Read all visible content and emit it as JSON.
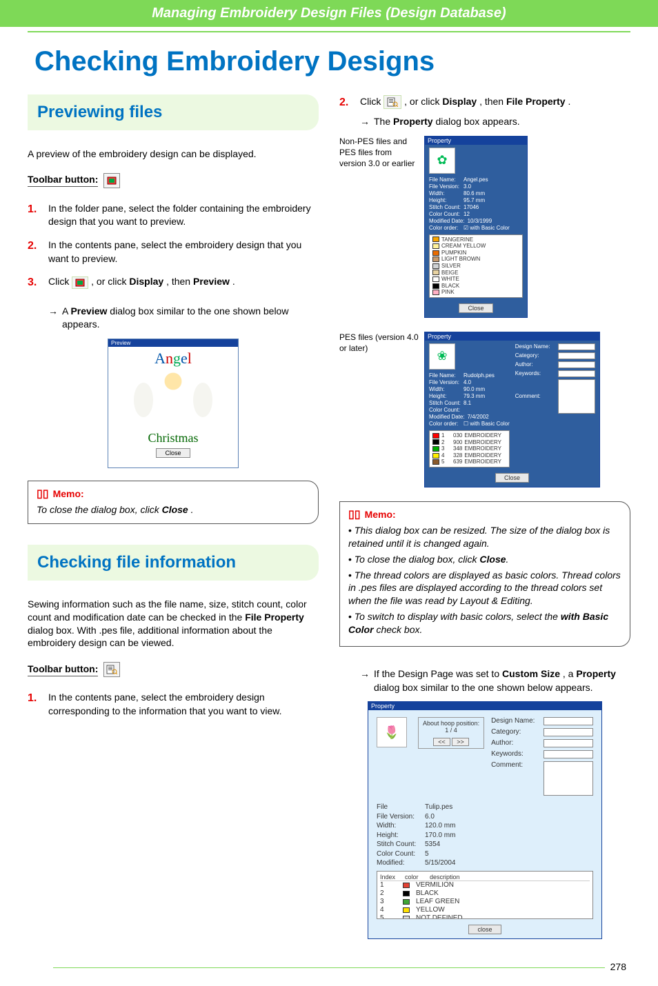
{
  "header": {
    "breadcrumb": "Managing Embroidery Design Files (Design Database)"
  },
  "title": "Checking Embroidery Designs",
  "section1": {
    "heading": "Previewing files",
    "intro": "A preview of the embroidery design can be displayed.",
    "toolbar_label": "Toolbar button:",
    "steps": {
      "s1": "In the folder pane, select the folder containing the embroidery design that you want to preview.",
      "s2": "In the contents pane, select the embroidery design that you want to preview.",
      "s3a": "Click ",
      "s3b": ", or click ",
      "s3_display": "Display",
      "s3_then": ", then ",
      "s3_preview": "Preview",
      "s3_period": "."
    },
    "result_a": "A ",
    "result_b": "Preview",
    "result_c": " dialog box similar to the one shown below appears.",
    "preview_dialog": {
      "title": "Preview",
      "word1": "Angel",
      "word2": "Christmas",
      "close": "Close"
    },
    "memo_label": "Memo:",
    "memo_text_a": "To close the dialog box, click ",
    "memo_text_b": "Close",
    "memo_text_c": "."
  },
  "section2": {
    "heading": "Checking file information",
    "intro_a": "Sewing information such as the file name, size, stitch count, color count and modification date can be checked in the ",
    "intro_b": "File Property",
    "intro_c": " dialog box. With .pes file, additional information about the embroidery design can be viewed.",
    "toolbar_label": "Toolbar button:",
    "steps": {
      "s1": "In the contents pane, select the embroidery design corresponding to the information that you want to view."
    }
  },
  "rightcol": {
    "step2_a": "Click ",
    "step2_b": ", or click ",
    "step2_display": "Display",
    "step2_then": ", then ",
    "step2_fp1": "File",
    "step2_fp2": "Property",
    "step2_period": ".",
    "result_a": "The ",
    "result_b": "Property",
    "result_c": " dialog box appears.",
    "caption1": "Non-PES files and PES files from version 3.0 or earlier",
    "caption2": "PES files (version 4.0 or later)",
    "dialog1": {
      "title": "Property",
      "file_name_label": "File Name:",
      "file_name_val": "Angel.pes",
      "file_version_label": "File Version:",
      "file_version_val": "3.0",
      "width_label": "Width:",
      "width_val": "80.6   mm",
      "height_label": "Height:",
      "height_val": "95.7   mm",
      "stitch_label": "Stitch Count:",
      "stitch_val": "17046",
      "color_label": "Color Count:",
      "color_val": "12",
      "modified_label": "Modified Date:",
      "modified_val": "10/3/1999",
      "color_order_label": "Color order:",
      "basic_color_label": "with Basic Color",
      "colors": [
        {
          "name": "TANGERINE",
          "hex": "#f7a500"
        },
        {
          "name": "CREAM YELLOW",
          "hex": "#fff29a"
        },
        {
          "name": "PUMPKIN",
          "hex": "#e96c00"
        },
        {
          "name": "LIGHT BROWN",
          "hex": "#c69a6d"
        },
        {
          "name": "SILVER",
          "hex": "#cfd2d4"
        },
        {
          "name": "BEIGE",
          "hex": "#e8d3a2"
        },
        {
          "name": "WHITE",
          "hex": "#ffffff"
        },
        {
          "name": "BLACK",
          "hex": "#000000"
        },
        {
          "name": "PINK",
          "hex": "#ffb0c4"
        }
      ],
      "close": "Close"
    },
    "dialog2": {
      "title": "Property",
      "file_name_label": "File Name:",
      "file_name_val": "Rudolph.pes",
      "file_version_label": "File Version:",
      "file_version_val": "4.0",
      "width_label": "Width:",
      "width_val": "90.0   mm",
      "height_label": "Height:",
      "height_val": "79.3   mm",
      "stitch_label": "Stitch Count:",
      "stitch_val": "8.1",
      "color_label": "Color Count:",
      "modified_label": "Modified Date:",
      "modified_val": "7/4/2002",
      "color_order_label": "Color order:",
      "basic_color_label": "with Basic Color",
      "design_name_label": "Design Name:",
      "category_label": "Category:",
      "author_label": "Author:",
      "keywords_label": "Keywords:",
      "comment_label": "Comment:",
      "colors": [
        {
          "idx": "1",
          "code": "030",
          "name": "EMBROIDERY",
          "hex": "#ff0000"
        },
        {
          "idx": "2",
          "code": "900",
          "name": "EMBROIDERY",
          "hex": "#000000"
        },
        {
          "idx": "3",
          "code": "348",
          "name": "EMBROIDERY",
          "hex": "#00aa00"
        },
        {
          "idx": "4",
          "code": "328",
          "name": "EMBROIDERY",
          "hex": "#ffee00"
        },
        {
          "idx": "5",
          "code": "639",
          "name": "EMBROIDERY",
          "hex": "#8a5a2b"
        }
      ],
      "close": "Close"
    },
    "memo_label": "Memo:",
    "memo_items": {
      "m1": "This dialog box can be resized. The size of the dialog box is retained until it is changed again.",
      "m2a": "To close the dialog box, click ",
      "m2b": "Close",
      "m2c": ".",
      "m3": "The thread colors are displayed as basic colors. Thread colors in .pes files are displayed according to the thread colors set when the file was read by Layout & Editing.",
      "m4a": "To switch to display with basic colors, select the ",
      "m4b": "with Basic Color",
      "m4c": " check box."
    },
    "result2_a": "If the Design Page was set to ",
    "result2_b": "Custom Size",
    "result2_c": ", a ",
    "result2_d": "Property",
    "result2_e": " dialog box similar to the one shown below appears.",
    "dialog3": {
      "title": "Property",
      "hoop_label": "About hoop position:",
      "hoop_val": "1 / 4",
      "nav_prev": "<<",
      "nav_next": ">>",
      "file_label": "File",
      "file_val": "Tulip.pes",
      "ver_label": "File Version:",
      "ver_val": "6.0",
      "width_label": "Width:",
      "width_val": "120.0   mm",
      "height_label": "Height:",
      "height_val": "170.0   mm",
      "stitch_label": "Stitch Count:",
      "stitch_val": "5354",
      "color_label": "Color Count:",
      "color_val": "5",
      "modified_label": "Modified:",
      "modified_val": "5/15/2004",
      "design_name_label": "Design Name:",
      "category_label": "Category:",
      "author_label": "Author:",
      "keywords_label": "Keywords:",
      "comment_label": "Comment:",
      "list_head_index": "Index",
      "list_head_color": "color",
      "list_head_desc": "description",
      "colors": [
        {
          "idx": "1",
          "name": "VERMILION",
          "hex": "#e34234"
        },
        {
          "idx": "2",
          "name": "BLACK",
          "hex": "#000000"
        },
        {
          "idx": "3",
          "name": "LEAF GREEN",
          "hex": "#3fa535"
        },
        {
          "idx": "4",
          "name": "YELLOW",
          "hex": "#ffe100"
        },
        {
          "idx": "5",
          "name": "NOT DEFINED",
          "hex": "#dcdcdc"
        }
      ],
      "close": "close"
    }
  },
  "page_number": "278"
}
